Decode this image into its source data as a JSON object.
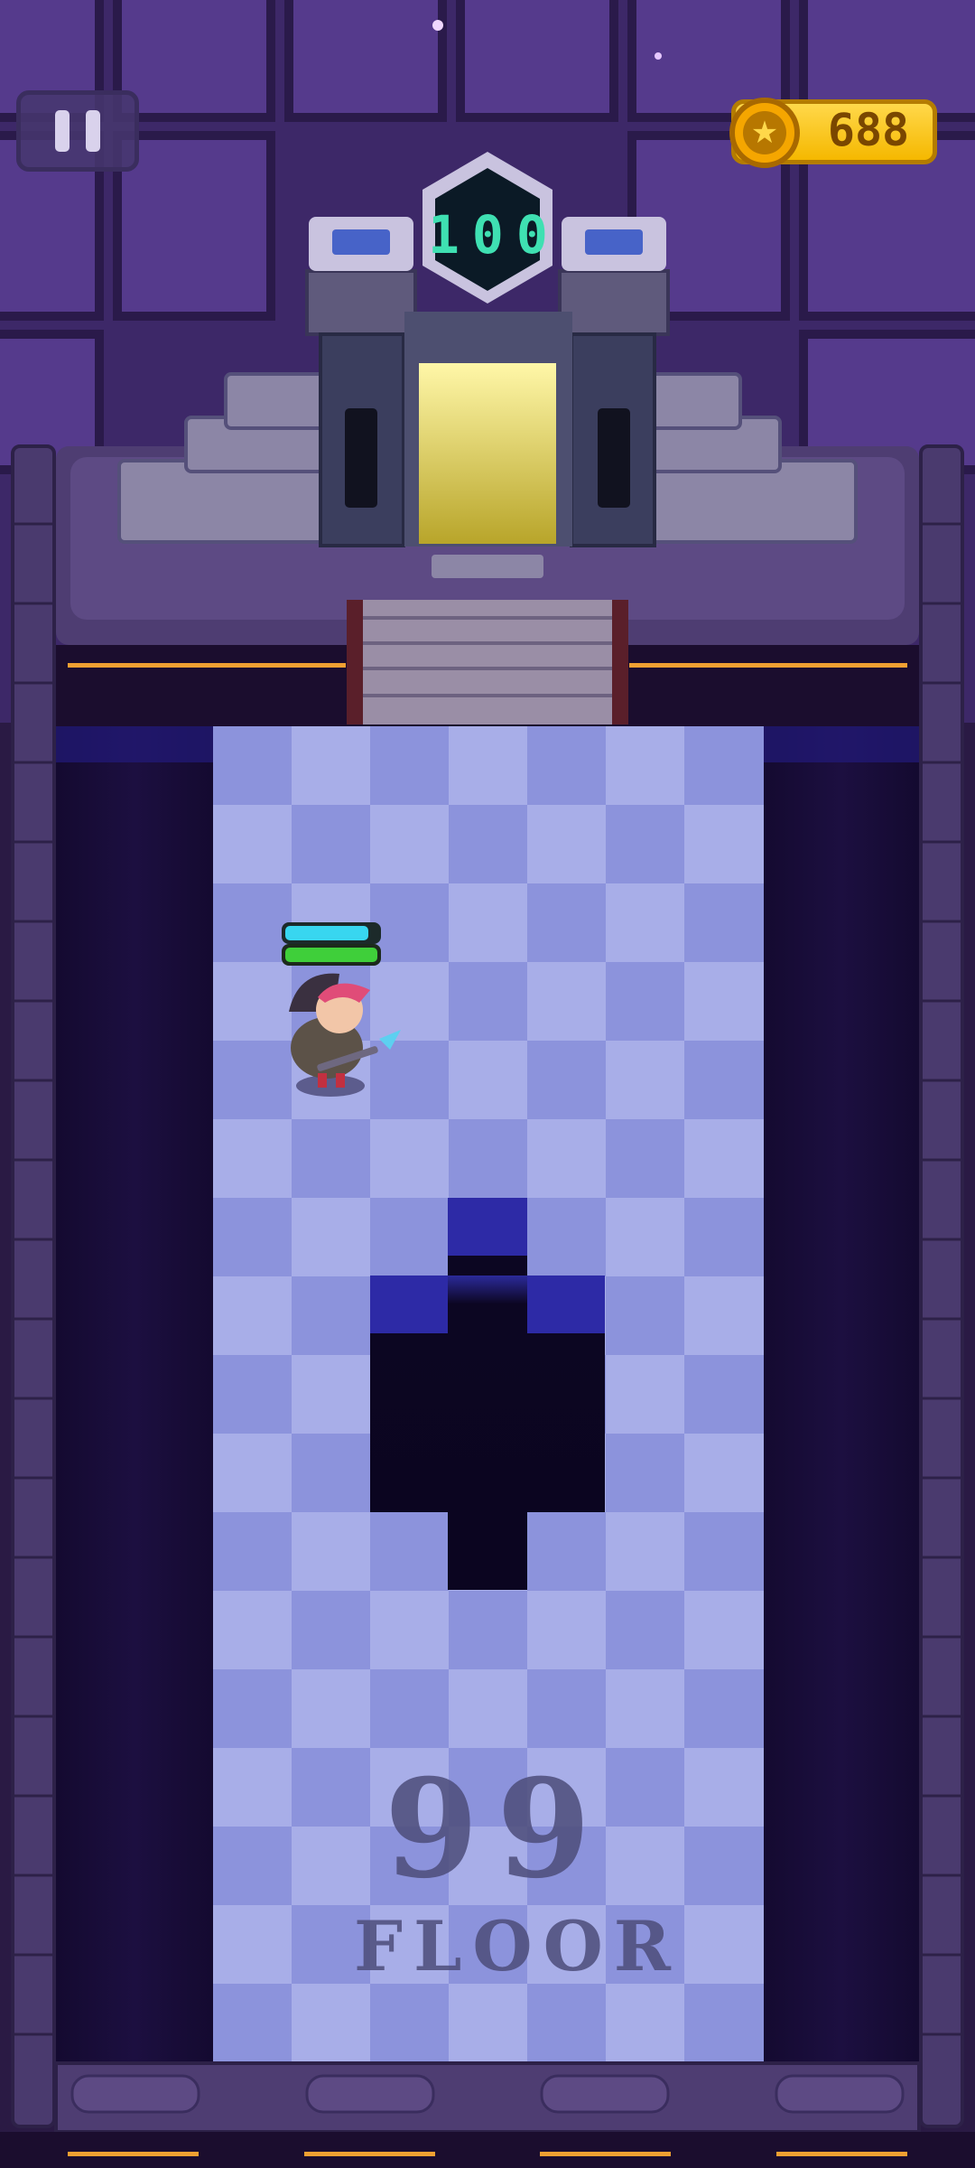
{
  "hud": {
    "coins": "688",
    "target_floor": "100",
    "current_floor_number": "99",
    "current_floor_word": "FLOOR"
  },
  "icons": {
    "pause": "pause-icon",
    "coin": "star-coin-icon",
    "portal": "portal-door-icon",
    "player": "hero-character"
  },
  "player": {
    "shield_level": 0.9,
    "health_level": 1.0
  },
  "colors": {
    "coin_accent": "#f5b800",
    "level_digits": "#3fe0b2",
    "shield_bar": "#38d6f0",
    "health_bar": "#3fcf3a",
    "floor_light": "#a8aee8",
    "floor_dark": "#8c93dc"
  }
}
